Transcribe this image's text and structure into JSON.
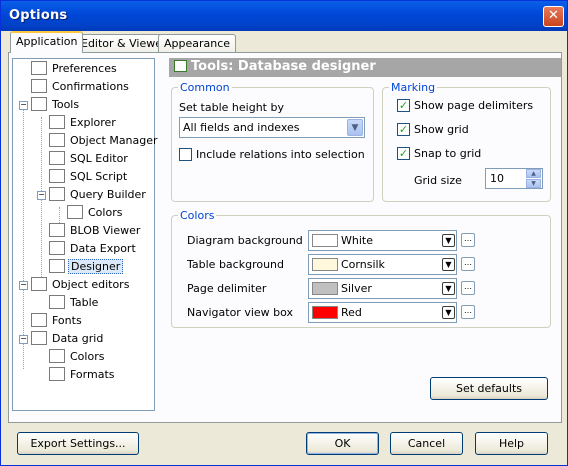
{
  "window": {
    "title": "Options"
  },
  "tabs": [
    {
      "label": "Application"
    },
    {
      "label": "Editor & Viewers"
    },
    {
      "label": "Appearance"
    }
  ],
  "tree": {
    "items": [
      {
        "label": "Preferences"
      },
      {
        "label": "Confirmations"
      },
      {
        "label": "Tools"
      },
      {
        "label": "Explorer"
      },
      {
        "label": "Object Manager"
      },
      {
        "label": "SQL Editor"
      },
      {
        "label": "SQL Script"
      },
      {
        "label": "Query Builder"
      },
      {
        "label": "Colors"
      },
      {
        "label": "BLOB Viewer"
      },
      {
        "label": "Data Export"
      },
      {
        "label": "Designer"
      },
      {
        "label": "Object editors"
      },
      {
        "label": "Table"
      },
      {
        "label": "Fonts"
      },
      {
        "label": "Data grid"
      },
      {
        "label": "Colors"
      },
      {
        "label": "Formats"
      }
    ],
    "selected": "Designer"
  },
  "panel": {
    "title": "Tools: Database designer",
    "common": {
      "title": "Common",
      "table_height_label": "Set table height by",
      "table_height_value": "All fields and indexes",
      "include_relations_label": "Include relations into selection",
      "include_relations_checked": false
    },
    "marking": {
      "title": "Marking",
      "show_page_delimiters": "Show page delimiters",
      "show_grid": "Show grid",
      "snap_to_grid": "Snap to grid",
      "grid_size_label": "Grid size",
      "grid_size_value": "10"
    },
    "colors": {
      "title": "Colors",
      "rows": [
        {
          "label": "Diagram background",
          "value": "White",
          "hex": "#ffffff"
        },
        {
          "label": "Table background",
          "value": "Cornsilk",
          "hex": "#fff8dc"
        },
        {
          "label": "Page delimiter",
          "value": "Silver",
          "hex": "#c0c0c0"
        },
        {
          "label": "Navigator view box",
          "value": "Red",
          "hex": "#ff0000"
        }
      ]
    },
    "set_defaults": "Set defaults"
  },
  "footer": {
    "export_settings": "Export Settings...",
    "ok": "OK",
    "cancel": "Cancel",
    "help": "Help"
  }
}
